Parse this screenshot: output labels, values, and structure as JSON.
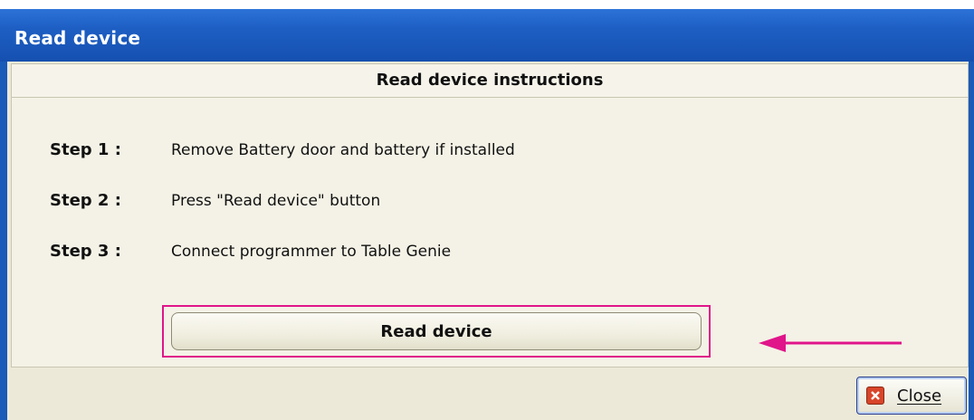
{
  "window": {
    "title": "Read device"
  },
  "panel": {
    "header": "Read device instructions",
    "steps": [
      {
        "label": "Step 1 :",
        "text": "Remove Battery door and battery if installed"
      },
      {
        "label": "Step 2 :",
        "text": "Press \"Read device\" button"
      },
      {
        "label": "Step 3 :",
        "text": "Connect programmer to Table Genie"
      }
    ],
    "read_button": "Read device"
  },
  "footer": {
    "close_label": "Close"
  },
  "colors": {
    "highlight": "#e0158a",
    "arrow": "#e0158a",
    "titlebar": "#1e5fc4"
  },
  "icons": {
    "close": "close-icon",
    "annotation_arrow": "arrow-left-icon"
  }
}
